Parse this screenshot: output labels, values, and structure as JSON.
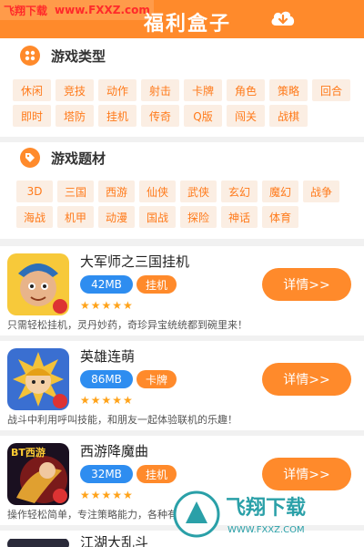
{
  "watermark_top": {
    "site_name": "飞翔下载",
    "url": "www.FXXZ.com"
  },
  "header": {
    "title": "福利盒子",
    "download_icon": "cloud-download-icon"
  },
  "categories": {
    "title": "游戏类型",
    "icon": "grid-icon",
    "tags": [
      "休闲",
      "竞技",
      "动作",
      "射击",
      "卡牌",
      "角色",
      "策略",
      "回合",
      "即时",
      "塔防",
      "挂机",
      "传奇",
      "Q版",
      "闯关",
      "战棋"
    ]
  },
  "themes": {
    "title": "游戏题材",
    "icon": "tag-icon",
    "tags": [
      "3D",
      "三国",
      "西游",
      "仙侠",
      "武侠",
      "玄幻",
      "魔幻",
      "战争",
      "海战",
      "机甲",
      "动漫",
      "国战",
      "探险",
      "神话",
      "体育"
    ]
  },
  "games": [
    {
      "name": "大军师之三国挂机",
      "size": "42MB",
      "category": "挂机",
      "stars": "★★★★★",
      "button": "详情>>",
      "desc": "只需轻松挂机，灵丹妙药，奇珍异宝统统都到碗里来！"
    },
    {
      "name": "英雄连萌",
      "size": "86MB",
      "category": "卡牌",
      "stars": "★★★★★",
      "button": "详情>>",
      "desc": "战斗中利用呼叫技能，和朋友一起体验联机的乐趣！"
    },
    {
      "name": "西游降魔曲",
      "size": "32MB",
      "category": "挂机",
      "stars": "★★★★★",
      "button": "详情>>",
      "desc": "操作轻松简单，专注策略能力，各种有"
    },
    {
      "name": "江湖大乱斗",
      "size": "",
      "category": "",
      "stars": "",
      "button": "",
      "desc": ""
    }
  ],
  "game3_thumb_text": "BT西游",
  "watermark_bottom": {
    "name": "飞翔下载",
    "url": "WWW.FXXZ.COM"
  },
  "colors": {
    "accent": "#ff8a2b",
    "tag_bg": "#fbeee3",
    "size_badge": "#2e8df0"
  }
}
